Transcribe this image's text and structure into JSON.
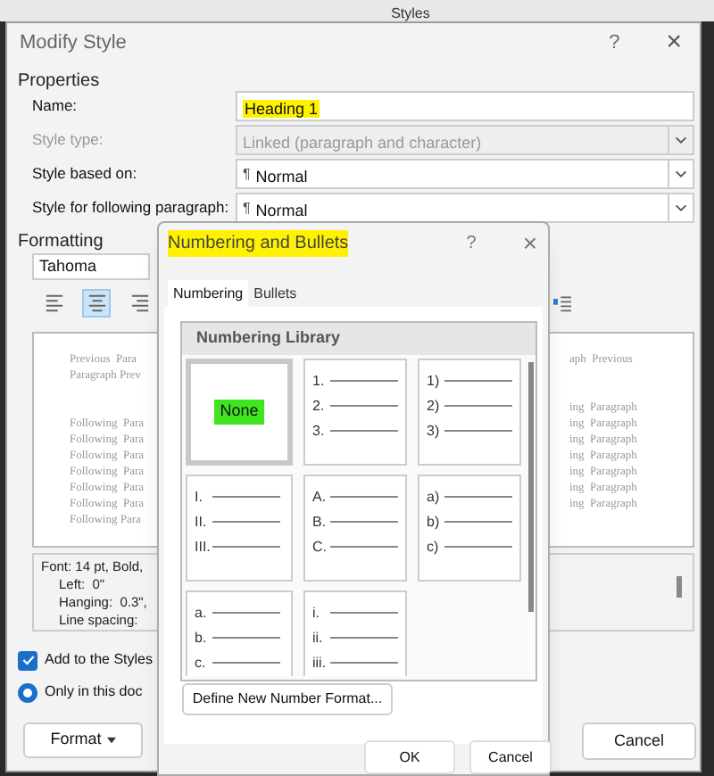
{
  "background_window": {
    "title": "Styles"
  },
  "window": {
    "title": "Modify Style",
    "help": "?",
    "close": "×"
  },
  "properties": {
    "heading": "Properties",
    "fields": [
      {
        "label": "Name:",
        "value": "Heading 1",
        "highlighted": true,
        "disabled": false,
        "kind": "text"
      },
      {
        "label": "Style type:",
        "value": "Linked (paragraph and character)",
        "highlighted": false,
        "disabled": true,
        "kind": "dropdown"
      },
      {
        "label": "Style based on:",
        "value": "Normal",
        "highlighted": false,
        "disabled": false,
        "kind": "dropdown",
        "pilcrow": "¶"
      },
      {
        "label": "Style for following paragraph:",
        "value": "Normal",
        "highlighted": false,
        "disabled": false,
        "kind": "dropdown",
        "pilcrow": "¶"
      }
    ]
  },
  "formatting": {
    "heading": "Formatting",
    "font": "Tahoma",
    "alignment": [
      {
        "kind": "left",
        "selected": false
      },
      {
        "kind": "center",
        "selected": true
      },
      {
        "kind": "right",
        "selected": false
      }
    ],
    "preview_left": {
      "previous": [
        "Previous  Para",
        "Paragraph Prev"
      ],
      "following": [
        "Following  Para",
        "Following  Para",
        "Following  Para",
        "Following  Para",
        "Following  Para",
        "Following  Para",
        "Following Para"
      ]
    },
    "preview_right": {
      "previous": [
        "aph  Previous"
      ],
      "following": [
        "ing  Paragraph",
        "ing  Paragraph",
        "ing  Paragraph",
        "ing  Paragraph",
        "ing  Paragraph",
        "ing  Paragraph",
        "ing  Paragraph"
      ]
    },
    "description": [
      "Font: 14 pt, Bold,",
      "Left:  0\"",
      "Hanging:  0.3\",",
      "Line spacing:"
    ]
  },
  "add_to_gallery": {
    "label": "Add to the Styles",
    "checked": true
  },
  "only_this_document": {
    "label": "Only in this doc",
    "selected": true
  },
  "format_button": "Format",
  "cancel_button": "Cancel",
  "numbering_dialog": {
    "title": "Numbering and Bullets",
    "help": "?",
    "close": "×",
    "tabs": [
      {
        "label": "Numbering",
        "selected": true
      },
      {
        "label": "Bullets",
        "selected": false
      }
    ],
    "library_title": "Numbering Library",
    "cells": [
      {
        "kind": "none",
        "label": "None",
        "selected": true
      },
      {
        "kind": "list",
        "markers": [
          "1.",
          "2.",
          "3."
        ],
        "selected": false
      },
      {
        "kind": "list",
        "markers": [
          "1)",
          "2)",
          "3)"
        ],
        "selected": false
      },
      {
        "kind": "list",
        "markers": [
          "I.",
          "II.",
          "III."
        ],
        "selected": false
      },
      {
        "kind": "list",
        "markers": [
          "A.",
          "B.",
          "C."
        ],
        "selected": false
      },
      {
        "kind": "list",
        "markers": [
          "a)",
          "b)",
          "c)"
        ],
        "selected": false
      },
      {
        "kind": "list",
        "markers": [
          "a.",
          "b.",
          "c."
        ],
        "selected": false
      },
      {
        "kind": "list",
        "markers": [
          "i.",
          "ii.",
          "iii."
        ],
        "selected": false
      }
    ],
    "define_button": "Define New Number Format...",
    "ok_button": "OK",
    "cancel_button": "Cancel"
  }
}
